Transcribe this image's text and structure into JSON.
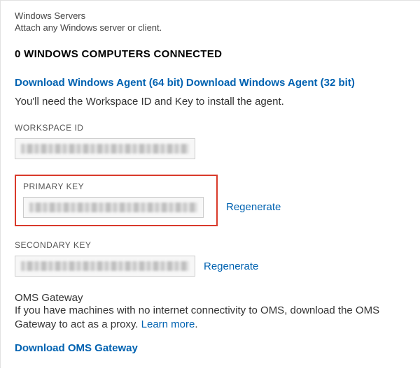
{
  "header": {
    "title": "Windows Servers",
    "subtitle": "Attach any Windows server or client."
  },
  "connected": {
    "heading": "0 WINDOWS COMPUTERS CONNECTED"
  },
  "downloads": {
    "win64": "Download Windows Agent (64 bit)",
    "win32": "Download Windows Agent (32 bit)",
    "note": "You'll need the Workspace ID and Key to install the agent."
  },
  "workspace": {
    "label": "WORKSPACE ID",
    "value": "(redacted)"
  },
  "primaryKey": {
    "label": "PRIMARY KEY",
    "value": "(redacted)",
    "regenerate": "Regenerate"
  },
  "secondaryKey": {
    "label": "SECONDARY KEY",
    "value": "(redacted)",
    "regenerate": "Regenerate"
  },
  "gateway": {
    "title": "OMS Gateway",
    "desc_prefix": "If you have machines with no internet connectivity to OMS, download the OMS Gateway to act as a proxy. ",
    "learn_more": "Learn more",
    "desc_suffix": ".",
    "download": "Download OMS Gateway"
  }
}
